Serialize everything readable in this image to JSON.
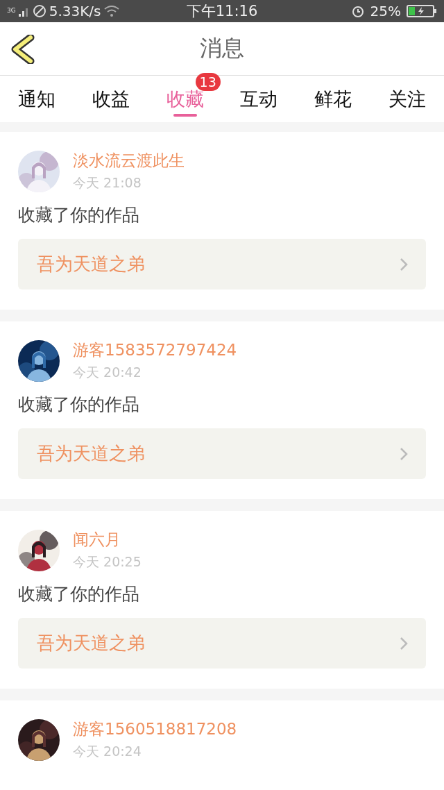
{
  "status_bar": {
    "network": "3G",
    "speed": "5.33K/s",
    "time": "下午11:16",
    "battery": "25%"
  },
  "header": {
    "title": "消息"
  },
  "tabs": [
    {
      "label": "通知",
      "selected": false
    },
    {
      "label": "收益",
      "selected": false
    },
    {
      "label": "收藏",
      "selected": true,
      "badge": "13"
    },
    {
      "label": "互动",
      "selected": false
    },
    {
      "label": "鲜花",
      "selected": false
    },
    {
      "label": "关注",
      "selected": false
    }
  ],
  "messages": [
    {
      "user": "淡水流云渡此生",
      "time": "今天 21:08",
      "action": "收藏了你的作品",
      "work": "吾为天道之弟"
    },
    {
      "user": "游客1583572797424",
      "time": "今天 20:42",
      "action": "收藏了你的作品",
      "work": "吾为天道之弟"
    },
    {
      "user": "闻六月",
      "time": "今天 20:25",
      "action": "收藏了你的作品",
      "work": "吾为天道之弟"
    },
    {
      "user": "游客1560518817208",
      "time": "今天 20:24"
    }
  ]
}
